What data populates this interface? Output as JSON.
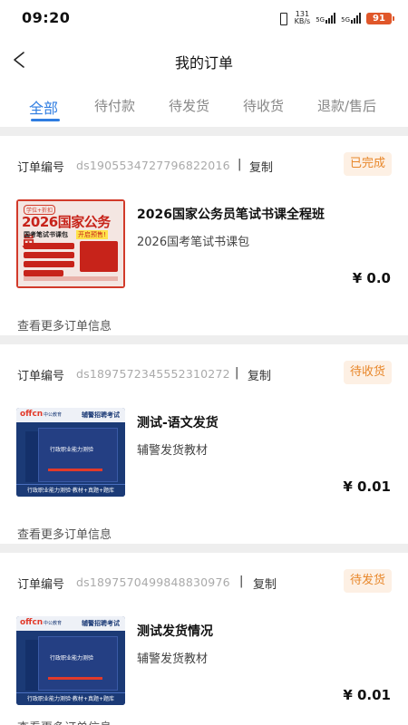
{
  "status_bar": {
    "time": "09:20",
    "net_speed_value": "131",
    "net_speed_unit": "KB/s",
    "sig1_label": "5G",
    "sig2_label": "5G",
    "battery": "91"
  },
  "header": {
    "title": "我的订单"
  },
  "tabs": [
    {
      "label": "全部",
      "active": true
    },
    {
      "label": "待付款"
    },
    {
      "label": "待发货"
    },
    {
      "label": "待收货"
    },
    {
      "label": "退款/售后"
    }
  ],
  "colors": {
    "accent": "#2f7de1",
    "status_text": "#e8872a",
    "status_bg": "#fdf0e4"
  },
  "orders": [
    {
      "order_no_label": "订单编号",
      "order_no": "ds1905534727796822016",
      "sep": "|",
      "copy": "复制",
      "status": "已完成",
      "cover": {
        "tag": "学位+折扣",
        "title": "2026国家公务员",
        "subtitle": "国考笔试书课包",
        "hot": "开启预售!"
      },
      "title": "2026国家公务员笔试书课全程班",
      "subtitle": "2026国考笔试书课包",
      "price": "¥ 0.0",
      "more": "查看更多订单信息"
    },
    {
      "order_no_label": "订单编号",
      "order_no": "ds1897572345552310272",
      "sep": "|",
      "copy": "复制",
      "status": "待收货",
      "cover": {
        "brand": "offcn",
        "brand2": "中公教育",
        "heading": "辅警招聘考试",
        "book_title": "行政职业能力测验",
        "footer": "行政职业能力测验·教材+真题+题库"
      },
      "title": "测试-语文发货",
      "subtitle": "辅警发货教材",
      "price": "¥ 0.01",
      "more": "查看更多订单信息"
    },
    {
      "order_no_label": "订单编号",
      "order_no": "ds1897570499848830976",
      "sep": "|",
      "copy": "复制",
      "status": "待发货",
      "cover": {
        "brand": "offcn",
        "brand2": "中公教育",
        "heading": "辅警招聘考试",
        "book_title": "行政职业能力测验",
        "footer": "行政职业能力测验·教材+真题+题库"
      },
      "title": "测试发货情况",
      "subtitle": "辅警发货教材",
      "price": "¥ 0.01",
      "more": "查看更多订单信息"
    }
  ]
}
